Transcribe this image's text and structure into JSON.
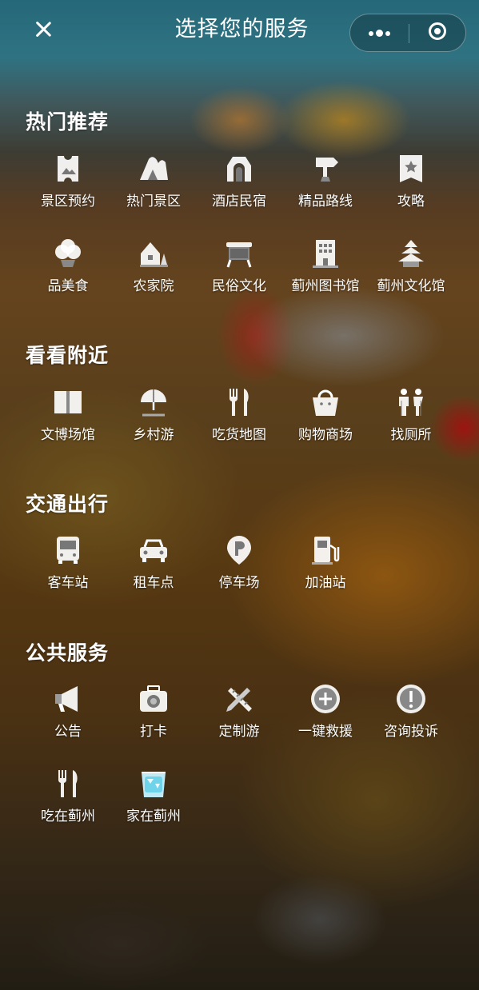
{
  "header": {
    "title": "选择您的服务"
  },
  "sections": [
    {
      "title": "热门推荐",
      "items": [
        {
          "label": "景区预约",
          "icon": "ticket-icon"
        },
        {
          "label": "热门景区",
          "icon": "mountain-icon"
        },
        {
          "label": "酒店民宿",
          "icon": "hotel-icon"
        },
        {
          "label": "精品路线",
          "icon": "signpost-icon"
        },
        {
          "label": "攻略",
          "icon": "bookmark-icon"
        },
        {
          "label": "品美食",
          "icon": "tree-icon"
        },
        {
          "label": "农家院",
          "icon": "farmhouse-icon"
        },
        {
          "label": "民俗文化",
          "icon": "drum-icon"
        },
        {
          "label": "蓟州图书馆",
          "icon": "library-building-icon"
        },
        {
          "label": "蓟州文化馆",
          "icon": "pagoda-icon"
        }
      ]
    },
    {
      "title": "看看附近",
      "items": [
        {
          "label": "文博场馆",
          "icon": "book-icon"
        },
        {
          "label": "乡村游",
          "icon": "umbrella-icon"
        },
        {
          "label": "吃货地图",
          "icon": "fork-knife-icon"
        },
        {
          "label": "购物商场",
          "icon": "shopping-basket-icon"
        },
        {
          "label": "找厕所",
          "icon": "toilet-icon"
        }
      ]
    },
    {
      "title": "交通出行",
      "items": [
        {
          "label": "客车站",
          "icon": "bus-icon"
        },
        {
          "label": "租车点",
          "icon": "car-icon"
        },
        {
          "label": "停车场",
          "icon": "parking-icon"
        },
        {
          "label": "加油站",
          "icon": "gas-station-icon"
        }
      ]
    },
    {
      "title": "公共服务",
      "items": [
        {
          "label": "公告",
          "icon": "megaphone-icon"
        },
        {
          "label": "打卡",
          "icon": "camera-icon"
        },
        {
          "label": "定制游",
          "icon": "ruler-pencil-icon"
        },
        {
          "label": "一键救援",
          "icon": "plus-circle-icon"
        },
        {
          "label": "咨询投诉",
          "icon": "exclamation-circle-icon"
        },
        {
          "label": "吃在蓟州",
          "icon": "fork-knife-icon"
        },
        {
          "label": "家在蓟州",
          "icon": "ice-cube-icon"
        }
      ]
    }
  ],
  "colors": {
    "icon_fill": "#ffffff",
    "icon_accent": "#6fd3ea"
  }
}
